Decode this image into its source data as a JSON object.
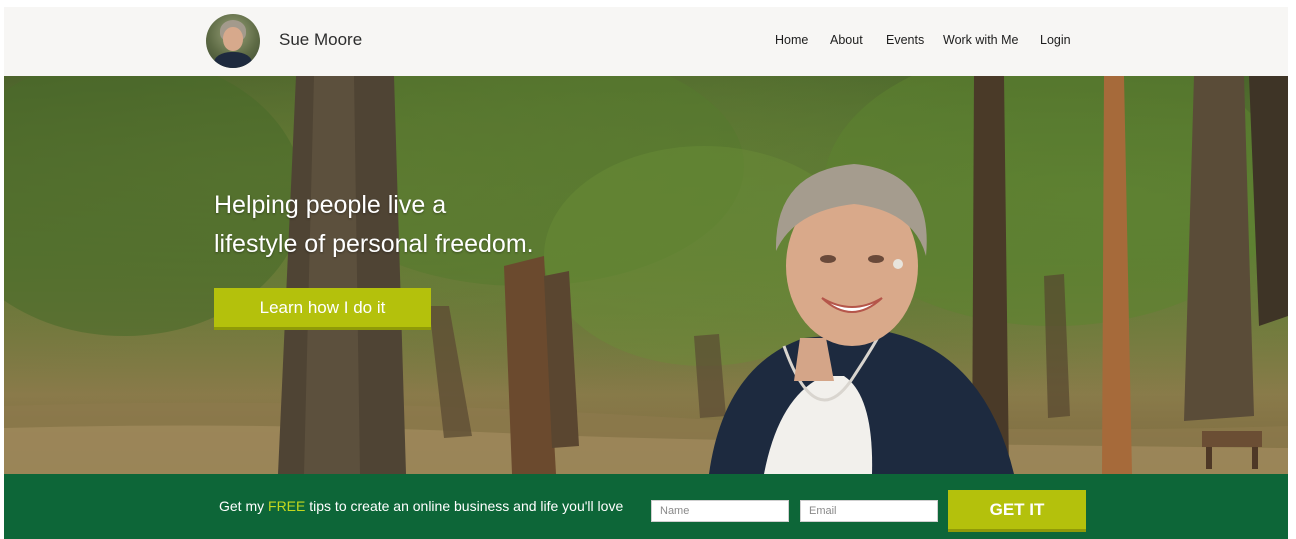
{
  "header": {
    "brand_name": "Sue Moore",
    "nav": [
      {
        "label": "Home"
      },
      {
        "label": "About"
      },
      {
        "label": "Events"
      },
      {
        "label": "Work with Me"
      },
      {
        "label": "Login"
      }
    ]
  },
  "hero": {
    "headline_line1": "Helping people live a",
    "headline_line2": "lifestyle of personal freedom.",
    "cta_label": "Learn how I do it"
  },
  "optin": {
    "text_before": "Get my ",
    "text_highlight": "FREE",
    "text_after": " tips to create an online business and life you'll love",
    "name_placeholder": "Name",
    "email_placeholder": "Email",
    "submit_label": "GET IT"
  },
  "colors": {
    "accent": "#b4c10c",
    "optin_background": "#0d6638",
    "free_highlight": "#c4d81e",
    "header_background": "#f7f6f4"
  }
}
